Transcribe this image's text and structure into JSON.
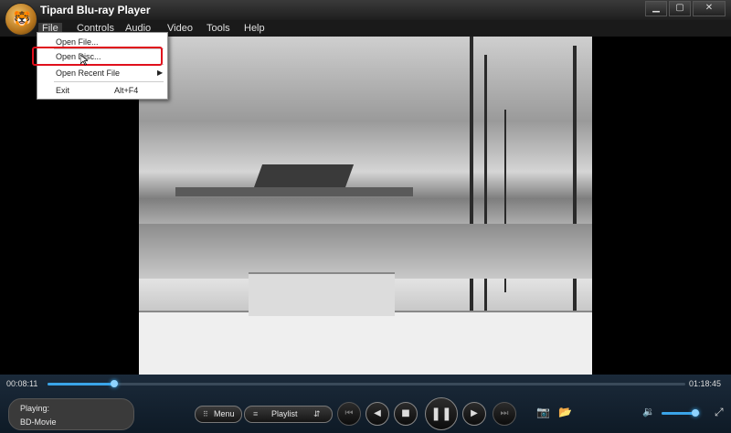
{
  "window": {
    "title": "Tipard Blu-ray Player",
    "min_glyph": "▁",
    "max_glyph": "▢",
    "close_glyph": "✕"
  },
  "menubar": {
    "items": [
      "File",
      "Controls",
      "Audio",
      "Video",
      "Tools",
      "Help"
    ]
  },
  "file_menu": {
    "items": [
      {
        "label": "Open File...",
        "shortcut": ""
      },
      {
        "label": "Open Disc...",
        "shortcut": ""
      },
      {
        "label": "Open Recent File",
        "shortcut": "",
        "submenu": true
      },
      {
        "label": "Exit",
        "shortcut": "Alt+F4"
      }
    ],
    "highlighted": "Open Disc..."
  },
  "playback": {
    "current_time": "00:08:11",
    "total_time": "01:18:45",
    "progress": 0.104
  },
  "info": {
    "playing_label": "Playing:",
    "title": "BD-Movie"
  },
  "controls": {
    "menu_label": "Menu",
    "playlist_label": "Playlist",
    "volume": 0.88
  },
  "colors": {
    "accent": "#3aa4e8",
    "highlight_border": "#e0101c",
    "bar_bg": "#0e1a26"
  }
}
